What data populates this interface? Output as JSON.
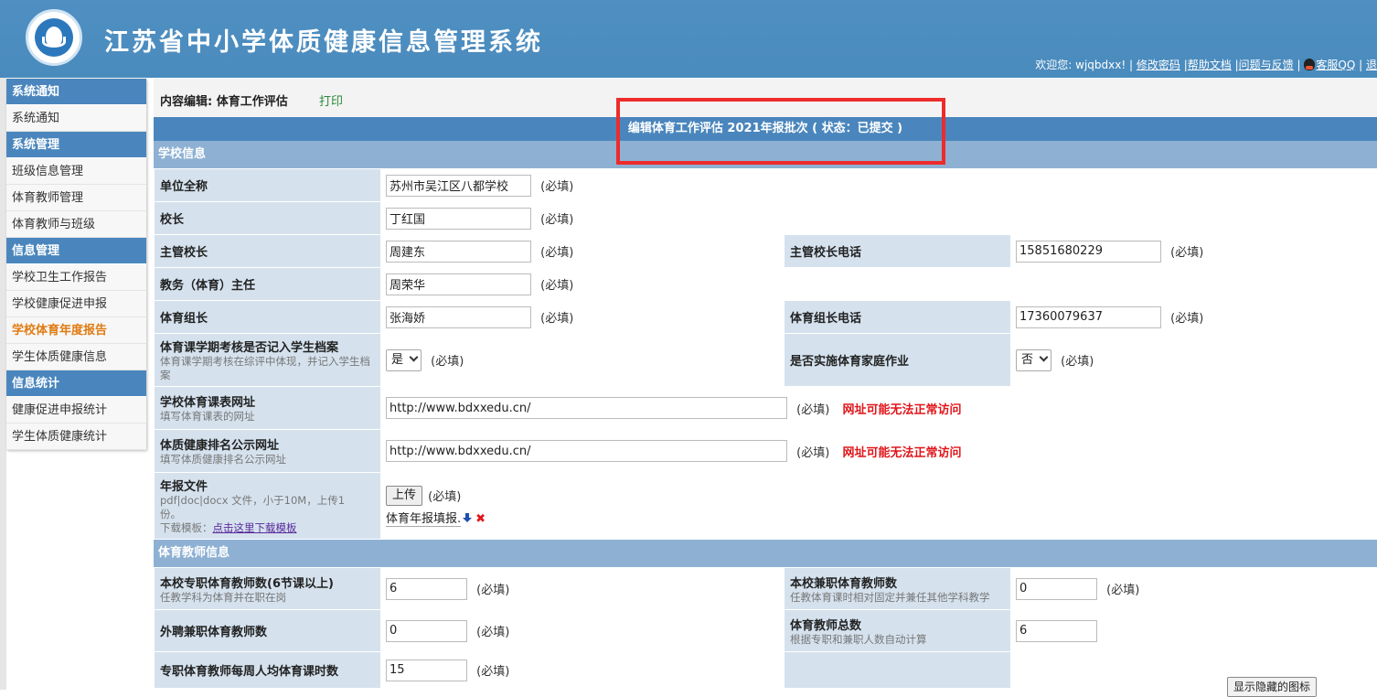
{
  "header": {
    "title": "江苏省中小学体质健康信息管理系统",
    "welcome": "欢迎您: wjqbdxx!",
    "links": [
      "修改密码",
      "帮助文档",
      "问题与反馈",
      "客服QQ",
      "退"
    ],
    "sep": "|"
  },
  "sidebar": {
    "groups": [
      {
        "title": "系统通知",
        "items": [
          "系统通知"
        ]
      },
      {
        "title": "系统管理",
        "items": [
          "班级信息管理",
          "体育教师管理",
          "体育教师与班级"
        ]
      },
      {
        "title": "信息管理",
        "items": [
          "学校卫生工作报告",
          "学校健康促进申报",
          "学校体育年度报告",
          "学生体质健康信息"
        ]
      },
      {
        "title": "信息统计",
        "items": [
          "健康促进申报统计",
          "学生体质健康统计"
        ]
      }
    ],
    "active_item": "学校体育年度报告"
  },
  "toolbar": {
    "label": "内容编辑: 体育工作评估",
    "print": "打印"
  },
  "form_title": "编辑体育工作评估 2021年报批次 ( 状态：已提交 )",
  "required": "(必填)",
  "warning": "网址可能无法正常访问",
  "school_section": {
    "title": "学校信息",
    "unit_name": {
      "label": "单位全称",
      "value": "苏州市吴江区八都学校"
    },
    "principal": {
      "label": "校长",
      "value": "丁红国"
    },
    "vice_principal": {
      "label": "主管校长",
      "value": "周建东"
    },
    "vice_principal_phone": {
      "label": "主管校长电话",
      "value": "15851680229"
    },
    "director": {
      "label": "教务（体育）主任",
      "value": "周荣华"
    },
    "pe_leader": {
      "label": "体育组长",
      "value": "张海娇"
    },
    "pe_leader_phone": {
      "label": "体育组长电话",
      "value": "17360079637"
    },
    "exam_record": {
      "label": "体育课学期考核是否记入学生档案",
      "hint": "体育课学期考核在综评中体现，并记入学生档案",
      "value": "是"
    },
    "homework": {
      "label": "是否实施体育家庭作业",
      "value": "否"
    },
    "schedule_url": {
      "label": "学校体育课表网址",
      "hint": "填写体育课表的网址",
      "value": "http://www.bdxxedu.cn/"
    },
    "ranking_url": {
      "label": "体质健康排名公示网址",
      "hint": "填写体质健康排名公示网址",
      "value": "http://www.bdxxedu.cn/"
    },
    "annual_file": {
      "label": "年报文件",
      "hint": "pdf|doc|docx 文件，小于10M，上传1份。",
      "template_prefix": "下载模板：",
      "template_link": "点击这里下载模板",
      "upload_button": "上传",
      "file_name": "体育年报填报."
    }
  },
  "teacher_section": {
    "title": "体育教师信息",
    "fulltime": {
      "label": "本校专职体育教师数(6节课以上)",
      "hint": "任教学科为体育并在职在岗",
      "value": "6"
    },
    "parttime": {
      "label": "本校兼职体育教师数",
      "hint": "任教体育课时相对固定并兼任其他学科教学",
      "value": "0"
    },
    "external": {
      "label": "外聘兼职体育教师数",
      "value": "0"
    },
    "total": {
      "label": "体育教师总数",
      "hint": "根据专职和兼职人数自动计算",
      "value": "6"
    },
    "weekly_hours": {
      "label": "专职体育教师每周人均体育课时数",
      "value": "15"
    }
  },
  "hidden_icons_button": "显示隐藏的图标",
  "colors": {
    "header": "#4a8bbd",
    "label_bg": "#d5e2ee",
    "section_bg": "#8eb1d3",
    "warning": "#e0161a",
    "highlight": "#ee2b2b",
    "active": "#e07b12"
  }
}
